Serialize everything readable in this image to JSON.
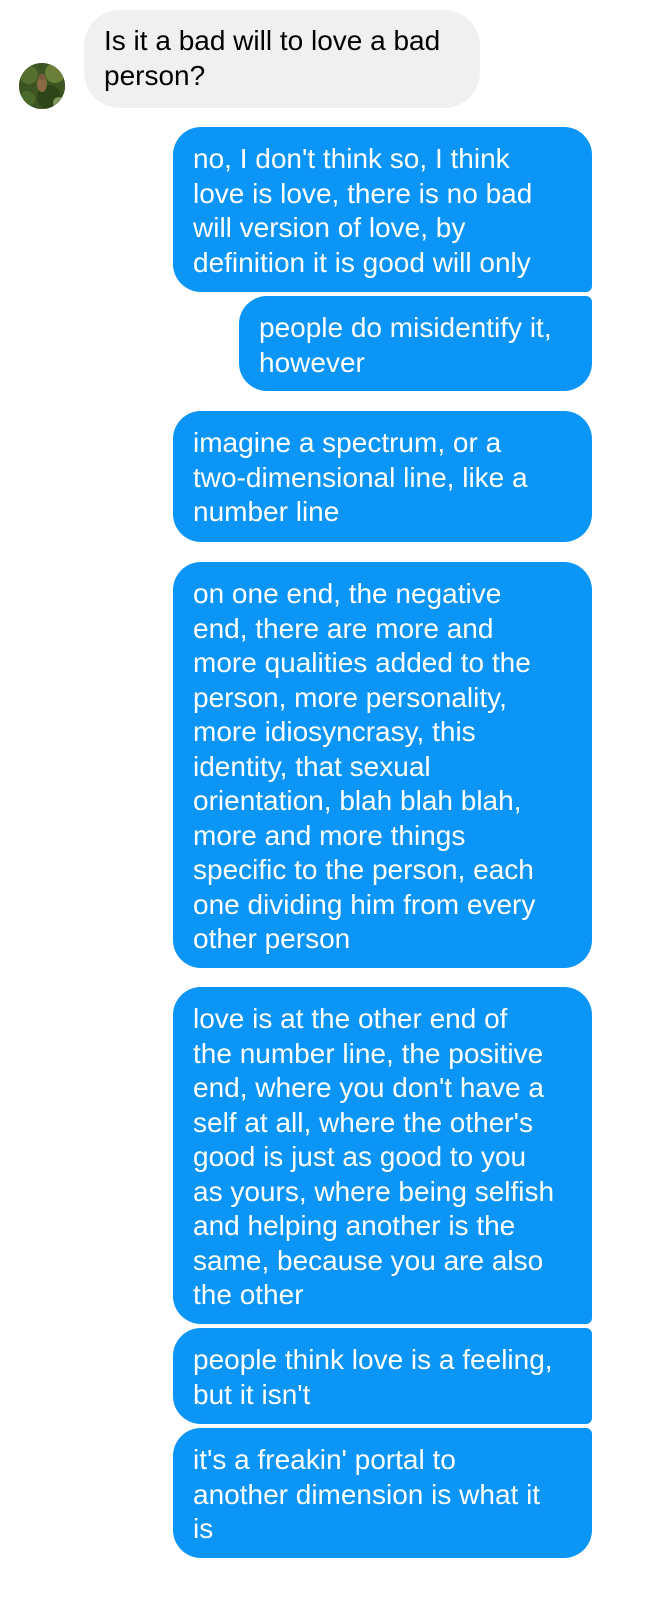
{
  "colors": {
    "incoming_bubble": "#f1f0f0",
    "outgoing_bubble": "#0a95f7",
    "outgoing_text": "#ffffff",
    "incoming_text": "#000000"
  },
  "contact": {
    "avatar_icon": "contact-avatar-photo"
  },
  "messages": [
    {
      "sender": "other",
      "text": "Is it a bad will to love a bad\nperson?"
    },
    {
      "sender": "me",
      "text": "no, I don't think so, I think\nlove is love, there is no bad\nwill version of love, by\ndefinition it is good will only"
    },
    {
      "sender": "me",
      "text": "people do misidentify it,\nhowever"
    },
    {
      "sender": "me",
      "text": "imagine a spectrum, or a\ntwo-dimensional line, like a\nnumber line"
    },
    {
      "sender": "me",
      "text": "on one end, the negative\nend, there are more and\nmore qualities added to the\nperson, more personality,\nmore idiosyncrasy, this\nidentity, that sexual\norientation, blah blah blah,\nmore and more things\nspecific to the person, each\none dividing him from every\nother person"
    },
    {
      "sender": "me",
      "text": "love is at the other end of\nthe number line, the positive\nend, where you don't have a\nself at all, where the other's\ngood is just as good to you\nas yours, where being selfish\nand helping another is the\nsame, because you are also\nthe other"
    },
    {
      "sender": "me",
      "text": "people think love is a feeling,\nbut it isn't"
    },
    {
      "sender": "me",
      "text": "it's a freakin' portal to\nanother dimension is what it\nis"
    }
  ]
}
